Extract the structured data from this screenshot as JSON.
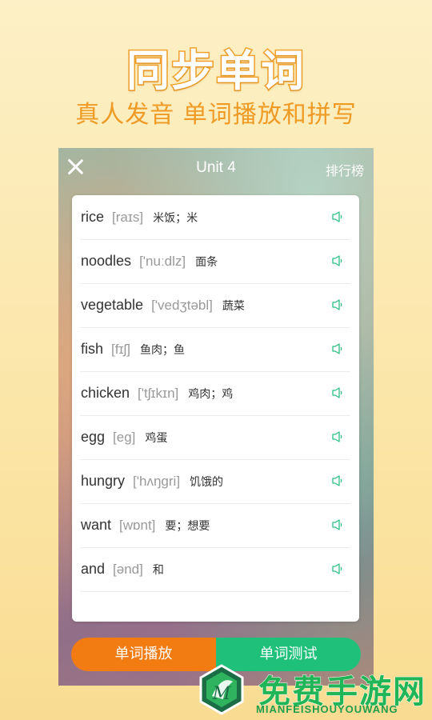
{
  "promo": {
    "title": "同步单词",
    "subtitle": "真人发音  单词播放和拼写"
  },
  "app": {
    "unit_title": "Unit 4",
    "ranking_label": "排行榜",
    "words": [
      {
        "word": "rice",
        "phonetic": "[raɪs]",
        "meaning": "米饭；米"
      },
      {
        "word": "noodles",
        "phonetic": "['nuːdlz]",
        "meaning": "面条"
      },
      {
        "word": "vegetable",
        "phonetic": "['vedʒtəbl]",
        "meaning": "蔬菜"
      },
      {
        "word": "fish",
        "phonetic": "[fɪʃ]",
        "meaning": "鱼肉；鱼"
      },
      {
        "word": "chicken",
        "phonetic": "['tʃɪkɪn]",
        "meaning": "鸡肉；鸡"
      },
      {
        "word": "egg",
        "phonetic": "[eg]",
        "meaning": "鸡蛋"
      },
      {
        "word": "hungry",
        "phonetic": "['hʌŋgri]",
        "meaning": "饥饿的"
      },
      {
        "word": "want",
        "phonetic": "[wɒnt]",
        "meaning": "要；想要"
      },
      {
        "word": "and",
        "phonetic": "[ənd]",
        "meaning": "和"
      }
    ],
    "play_button": "单词播放",
    "test_button": "单词测试"
  },
  "watermark": {
    "text": "免费手游网",
    "subtext": "MIANFEISHOUYOUWANG"
  },
  "colors": {
    "promo_orange": "#f1a22c",
    "play_orange": "#f27b12",
    "test_green": "#1fc07a",
    "speaker_green": "#2bbf83"
  },
  "icons": {
    "close": "close-icon",
    "speaker": "speaker-icon",
    "logo": "watermark-logo-icon"
  }
}
